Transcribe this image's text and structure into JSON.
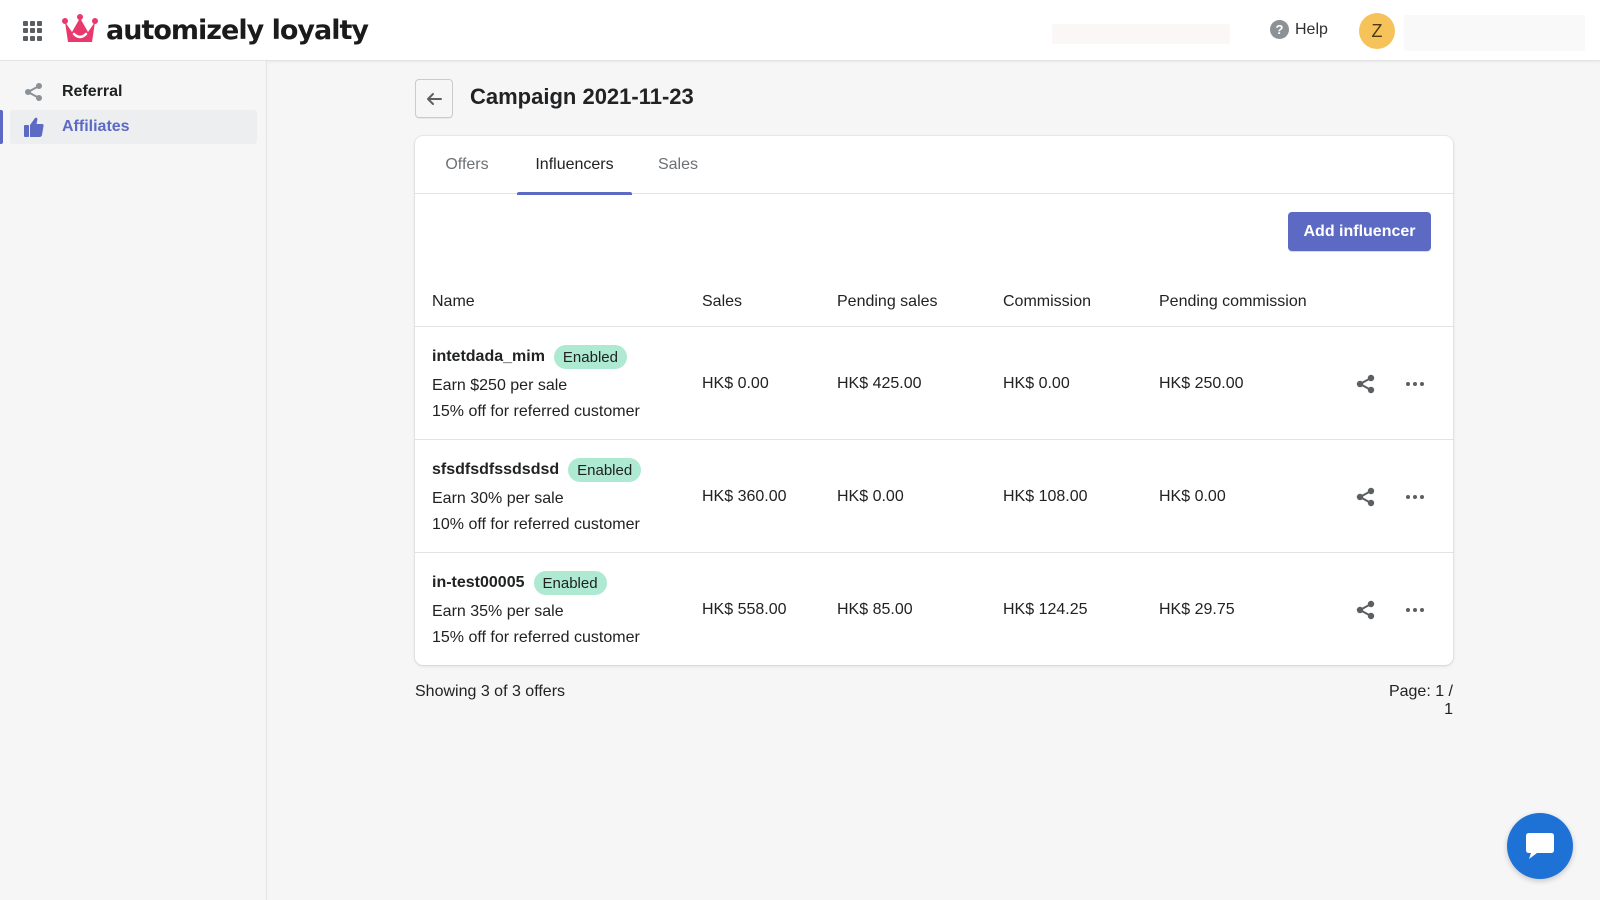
{
  "header": {
    "logo_text": "automizely loyalty",
    "help_label": "Help",
    "avatar_initial": "Z"
  },
  "sidebar": {
    "items": [
      {
        "label": "Referral",
        "icon": "share-icon",
        "active": false
      },
      {
        "label": "Affiliates",
        "icon": "thumbs-up-icon",
        "active": true
      }
    ]
  },
  "page": {
    "title": "Campaign 2021-11-23",
    "back_icon": "arrow-left-icon"
  },
  "tabs": [
    {
      "label": "Offers",
      "active": false
    },
    {
      "label": "Influencers",
      "active": true
    },
    {
      "label": "Sales",
      "active": false
    }
  ],
  "toolbar": {
    "add_button_label": "Add influencer"
  },
  "table": {
    "columns": [
      "Name",
      "Sales",
      "Pending sales",
      "Commission",
      "Pending commission"
    ],
    "rows": [
      {
        "name": "intetdada_mim",
        "status": "Enabled",
        "earn": "Earn $250 per sale",
        "discount": "15% off for referred customer",
        "sales": "HK$ 0.00",
        "pending_sales": "HK$ 425.00",
        "commission": "HK$ 0.00",
        "pending_commission": "HK$ 250.00"
      },
      {
        "name": "sfsdfsdfssdsdsd",
        "status": "Enabled",
        "earn": "Earn 30% per sale",
        "discount": "10% off for referred customer",
        "sales": "HK$ 360.00",
        "pending_sales": "HK$ 0.00",
        "commission": "HK$ 108.00",
        "pending_commission": "HK$ 0.00"
      },
      {
        "name": "in-test00005",
        "status": "Enabled",
        "earn": "Earn 35% per sale",
        "discount": "15% off for referred customer",
        "sales": "HK$ 558.00",
        "pending_sales": "HK$ 85.00",
        "commission": "HK$ 124.25",
        "pending_commission": "HK$ 29.75"
      }
    ]
  },
  "footer": {
    "showing_text": "Showing 3 of 3 offers",
    "page_text": "Page: 1 / 1"
  },
  "colors": {
    "accent": "#5c6ac4",
    "badge_bg": "#aee9d1",
    "logo_crown": "#e8386d",
    "chat_button": "#1e72d6",
    "avatar_bg": "#f6c35b"
  }
}
